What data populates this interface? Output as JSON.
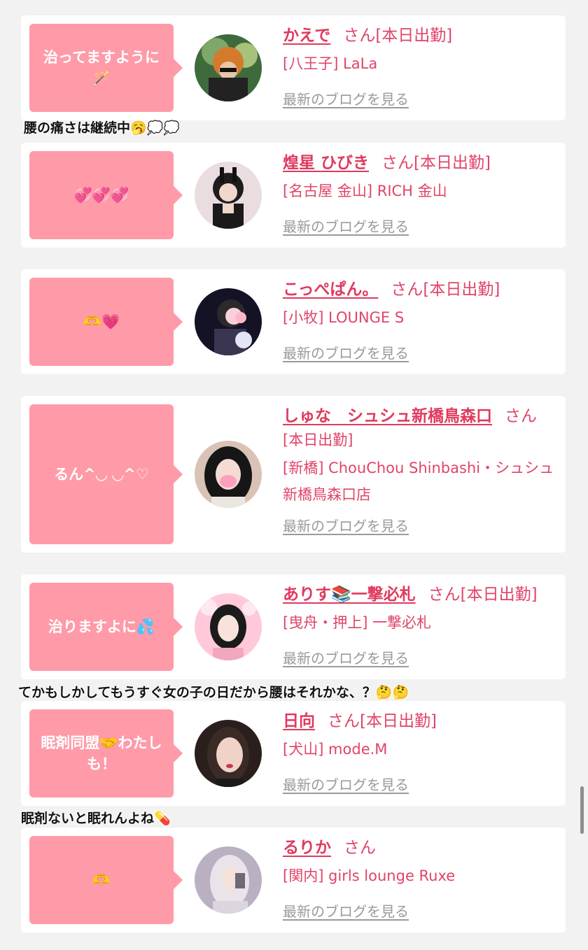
{
  "cards": [
    {
      "bubble": "治ってますように🪄",
      "name": "かえで",
      "san": "さん",
      "status": "[本日出勤]",
      "shop": "[八王子] LaLa",
      "blog": "最新のブログを見る"
    },
    {
      "bubble": "💞💞💞",
      "name": "煌星 ひびき",
      "san": "さん",
      "status": "[本日出勤]",
      "shop": "[名古屋 金山] RICH 金山",
      "blog": "最新のブログを見る"
    },
    {
      "bubble": "🫶💗",
      "name": "こっぺぱん。",
      "san": "さん",
      "status": "[本日出勤]",
      "shop": "[小牧] LOUNGE S",
      "blog": "最新のブログを見る"
    },
    {
      "bubble": "るん^◡ ◡^♡",
      "name": "しゅな　シュシュ新橋鳥森口",
      "san": "さん",
      "status": "[本日出勤]",
      "shop": "[新橋] ChouChou Shinbashi・シュシュ新橋鳥森口店",
      "blog": "最新のブログを見る"
    },
    {
      "bubble": "治りますよに💦",
      "name": "ありす📚一撃必札",
      "san": "さん",
      "status": "[本日出勤]",
      "shop": "[曳舟・押上] 一撃必札",
      "blog": "最新のブログを見る"
    },
    {
      "bubble": "眠剤同盟🤝わたしも！",
      "name": "日向",
      "san": "さん",
      "status": "[本日出勤]",
      "shop": "[犬山] mode.M",
      "blog": "最新のブログを見る"
    },
    {
      "bubble": "🫶",
      "name": "るりか",
      "san": "さん",
      "status": "",
      "shop": "[関内] girls lounge Ruxe",
      "blog": "最新のブログを見る"
    }
  ],
  "overlay_comments": [
    "腰の痛さは継続中🥱💭💭",
    "てかもしかしてもうすぐ女の子の日だから腰はそれかな、？🤔🤔",
    "眠剤ないと眠れんよね💊"
  ],
  "colors": {
    "bubble": "#ff9aa9",
    "accent": "#e03a5e",
    "link_gray": "#9a9a9a",
    "background": "#f2f2f2"
  }
}
